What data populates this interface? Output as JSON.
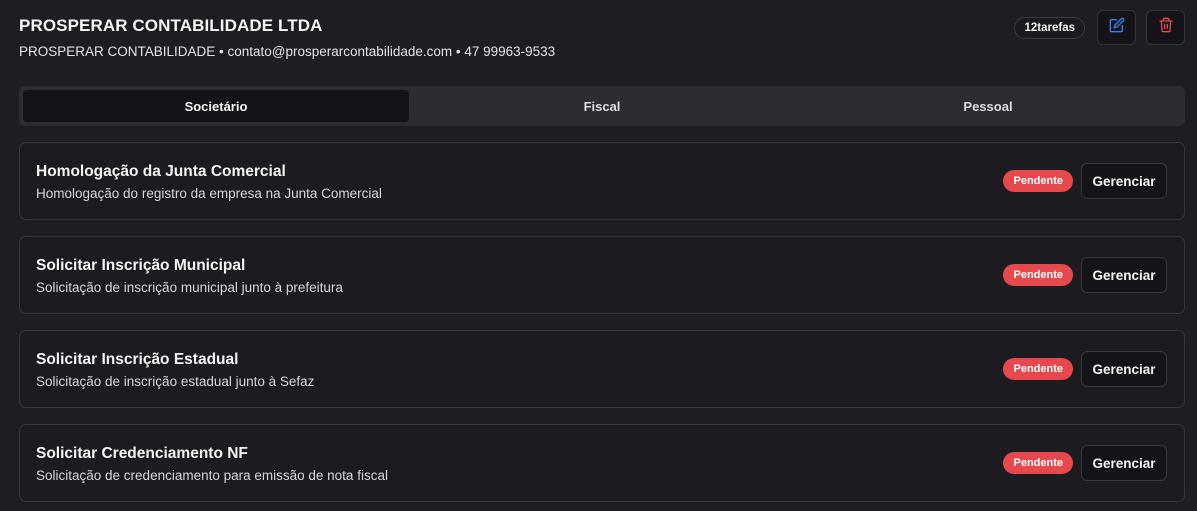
{
  "header": {
    "company_name": "PROSPERAR CONTABILIDADE LTDA",
    "company_meta": "PROSPERAR CONTABILIDADE • contato@prosperarcontabilidade.com • 47 99963-9533",
    "task_badge": "12tarefas",
    "edit_icon": "edit-icon",
    "delete_icon": "trash-icon",
    "colors": {
      "edit": "#3b82f6",
      "delete": "#e5484d"
    }
  },
  "tabs": [
    {
      "label": "Societário",
      "active": true
    },
    {
      "label": "Fiscal",
      "active": false
    },
    {
      "label": "Pessoal",
      "active": false
    }
  ],
  "tasks": [
    {
      "title": "Homologação da Junta Comercial",
      "description": "Homologação do registro da empresa na Junta Comercial",
      "status": "Pendente",
      "action": "Gerenciar"
    },
    {
      "title": "Solicitar Inscrição Municipal",
      "description": "Solicitação de inscrição municipal junto à prefeitura",
      "status": "Pendente",
      "action": "Gerenciar"
    },
    {
      "title": "Solicitar Inscrição Estadual",
      "description": "Solicitação de inscrição estadual junto à Sefaz",
      "status": "Pendente",
      "action": "Gerenciar"
    },
    {
      "title": "Solicitar Credenciamento NF",
      "description": "Solicitação de credenciamento para emissão de nota fiscal",
      "status": "Pendente",
      "action": "Gerenciar"
    }
  ],
  "status_color": "#e5484d"
}
